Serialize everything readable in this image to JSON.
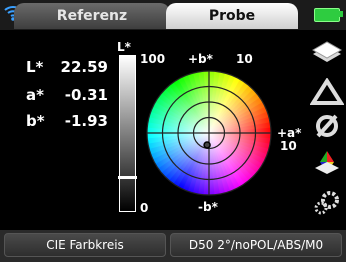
{
  "tabs": {
    "reference_label": "Referenz",
    "sample_label": "Probe"
  },
  "lab": {
    "l_label": "L*",
    "l_value": "22.59",
    "a_label": "a*",
    "a_value": "-0.31",
    "b_label": "b*",
    "b_value": "-1.93"
  },
  "lightness_bar": {
    "title": "L*",
    "top_label": "100",
    "bottom_label": "0",
    "level_percent": 22.59
  },
  "color_wheel": {
    "plus_b_label": "+b*",
    "plus_b_scale": "10",
    "minus_b_label": "-b*",
    "plus_a_label": "+a*",
    "plus_a_scale": "10",
    "point": {
      "a": -0.31,
      "b": -1.93
    },
    "scale_max": 10
  },
  "sidebar_icons": [
    "measure-icon",
    "delta-icon",
    "null-icon",
    "color-chart-icon",
    "settings-gear-icon"
  ],
  "status": {
    "wifi_icon": "wifi-icon",
    "battery_icon": "battery-icon",
    "battery_color": "#2ecc40"
  },
  "bottom": {
    "mode_button": "CIE Farbkreis",
    "settings_button": "D50 2°/noPOL/ABS/M0"
  }
}
